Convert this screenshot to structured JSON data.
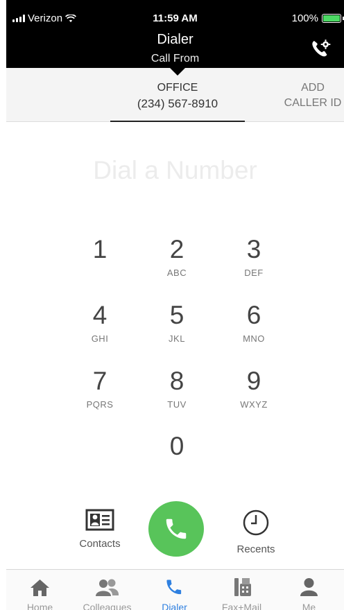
{
  "status_bar": {
    "carrier": "Verizon",
    "time": "11:59 AM",
    "battery": "100%"
  },
  "header": {
    "title": "Dialer",
    "subtitle": "Call From"
  },
  "caller_id": {
    "office_label": "OFFICE",
    "office_number": "(234) 567-8910",
    "add_line1": "ADD",
    "add_line2": "CALLER ID"
  },
  "dial_input": {
    "placeholder": "Dial a Number"
  },
  "keypad": [
    {
      "digit": "1",
      "letters": ""
    },
    {
      "digit": "2",
      "letters": "ABC"
    },
    {
      "digit": "3",
      "letters": "DEF"
    },
    {
      "digit": "4",
      "letters": "GHI"
    },
    {
      "digit": "5",
      "letters": "JKL"
    },
    {
      "digit": "6",
      "letters": "MNO"
    },
    {
      "digit": "7",
      "letters": "PQRS"
    },
    {
      "digit": "8",
      "letters": "TUV"
    },
    {
      "digit": "9",
      "letters": "WXYZ"
    },
    {
      "digit": "0",
      "letters": ""
    }
  ],
  "actions": {
    "contacts": "Contacts",
    "recents": "Recents"
  },
  "tabbar": [
    {
      "label": "Home",
      "icon": "home-icon"
    },
    {
      "label": "Colleagues",
      "icon": "colleagues-icon"
    },
    {
      "label": "Dialer",
      "icon": "phone-icon",
      "active": true
    },
    {
      "label": "Fax+Mail",
      "icon": "fax-icon"
    },
    {
      "label": "Me",
      "icon": "person-icon"
    }
  ],
  "colors": {
    "accent": "#2f80e0",
    "call_green": "#58c45a",
    "header_bg": "#000000",
    "battery_green": "#4cd964"
  }
}
